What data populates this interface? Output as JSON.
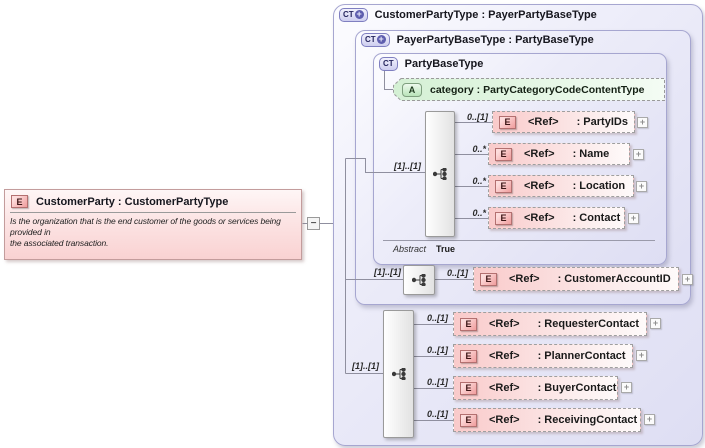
{
  "palette": {
    "container_fill": "#e3e3f5",
    "container_border": "#a6a6d0",
    "element_fill": "#f8caca",
    "element_border": "#c39c9c",
    "attribute_fill": "#dcf3dc",
    "ct_accent": "#5d5dae",
    "line": "#8f8f9f"
  },
  "icons": {
    "element": "E",
    "complex_type": "CT",
    "attribute": "A",
    "derived_badge": "+"
  },
  "connectors": {
    "collapse": "−",
    "expand": "+"
  },
  "element": {
    "title": "CustomerParty : CustomerPartyType",
    "description": "Is the organization that is the end customer of the goods or services being\nprovided in\nthe associated transaction."
  },
  "types": {
    "outer": {
      "title": "CustomerPartyType : PayerPartyBaseType"
    },
    "payer": {
      "title": "PayerPartyBaseType : PartyBaseType"
    },
    "base": {
      "title": "PartyBaseType",
      "abstract_label": "Abstract",
      "abstract_value": "True"
    }
  },
  "attribute": {
    "label": "category : PartyCategoryCodeContentType"
  },
  "groups": [
    {
      "cardinality": "[1]..[1]",
      "compositor": "sequence",
      "rows": [
        {
          "cardinality": "0..[1]",
          "ref": "<Ref>",
          "name": ": PartyIDs"
        },
        {
          "cardinality": "0..*",
          "ref": "<Ref>",
          "name": ": Name"
        },
        {
          "cardinality": "0..*",
          "ref": "<Ref>",
          "name": ": Location"
        },
        {
          "cardinality": "0..*",
          "ref": "<Ref>",
          "name": ": Contact"
        }
      ]
    },
    {
      "cardinality": "[1]..[1]",
      "compositor": "sequence",
      "rows": [
        {
          "cardinality": "0..[1]",
          "ref": "<Ref>",
          "name": ": CustomerAccountID"
        }
      ]
    },
    {
      "cardinality": "[1]..[1]",
      "compositor": "sequence",
      "rows": [
        {
          "cardinality": "0..[1]",
          "ref": "<Ref>",
          "name": ": RequesterContact"
        },
        {
          "cardinality": "0..[1]",
          "ref": "<Ref>",
          "name": ": PlannerContact"
        },
        {
          "cardinality": "0..[1]",
          "ref": "<Ref>",
          "name": ": BuyerContact"
        },
        {
          "cardinality": "0..[1]",
          "ref": "<Ref>",
          "name": ": ReceivingContact"
        }
      ]
    }
  ]
}
